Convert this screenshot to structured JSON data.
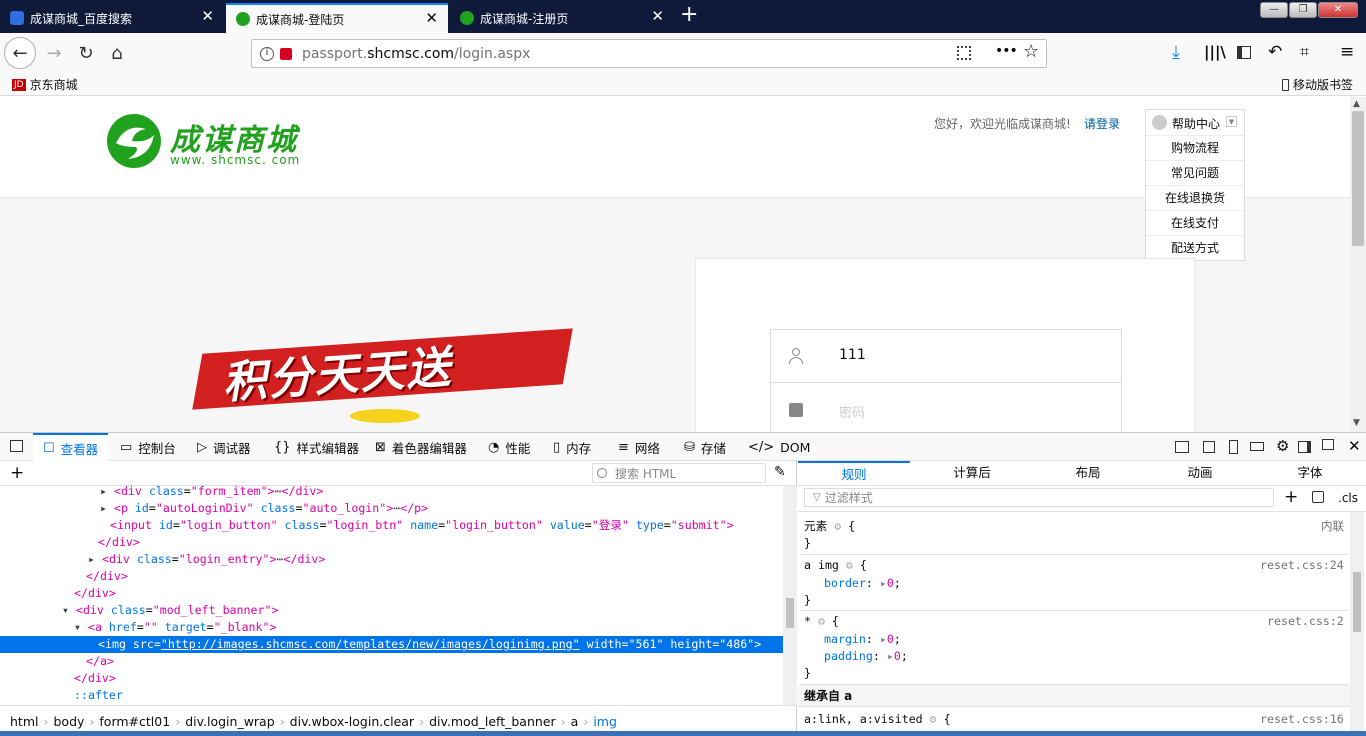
{
  "tabs": [
    {
      "title": "成谋商城_百度搜索",
      "close": "✕"
    },
    {
      "title": "成谋商城-登陆页",
      "close": "✕"
    },
    {
      "title": "成谋商城-注册页",
      "close": "✕"
    }
  ],
  "new_tab": "+",
  "window_controls": {
    "minimize": "—",
    "maximize": "❐",
    "close": "✕"
  },
  "nav": {
    "back": "←",
    "forward": "→",
    "reload": "↻",
    "home": "⌂"
  },
  "url": {
    "prefix": "passport.",
    "domain": "shcmsc.com",
    "path": "/login.aspx"
  },
  "toolbar_icons": [
    "qr-code-icon",
    "more-icon",
    "star-icon",
    "download-icon",
    "library-icon",
    "sidebar-icon",
    "undo-icon",
    "crop-icon",
    "menu-icon"
  ],
  "bookmarks": {
    "left_badge": "JD",
    "left": "京东商城",
    "right": "移动版书签"
  },
  "site": {
    "logo_cn": "成谋商城",
    "logo_url": "www. shcmsc. com",
    "welcome": "您好，欢迎光临成谋商城!",
    "login_link": "请登录",
    "help_center": "帮助中心",
    "help_menu": [
      "购物流程",
      "常见问题",
      "在线退换货",
      "在线支付",
      "配送方式"
    ],
    "banner": "积分天天送",
    "username_value": "111",
    "password_placeholder": "密码"
  },
  "devtools": {
    "tabs": [
      "查看器",
      "控制台",
      "调试器",
      "样式编辑器",
      "着色器编辑器",
      "性能",
      "内存",
      "网络",
      "存储",
      "DOM"
    ],
    "add": "+",
    "search_placeholder": "搜索 HTML",
    "html_lines": [
      {
        "a": "<div ",
        "b": "class=",
        "c": "\"form_item\"",
        "d": ">",
        "e": "",
        "f": "</div>"
      },
      {
        "a": "<p ",
        "b": "id=",
        "c": "\"autoLoginDiv\"",
        "d": " class=\"auto_login\">",
        "e": "",
        "f": "</p>"
      }
    ],
    "markup": [
      "<div class=\"form_item\">",
      "<p id=\"autoLoginDiv\" class=\"auto_login\">",
      "<input id=\"login_button\" class=\"login_btn\" name=\"login_button\" value=\"登录\" type=\"submit\">",
      "</div>",
      "<div class=\"login_entry\">",
      "</div>",
      "</div>",
      "<div class=\"mod_left_banner\">",
      "<a href=\"\" target=\"_blank\">",
      "<img src=\"http://images.shcmsc.com/templates/new/images/loginimg.png\" width=\"561\" height=\"486\">",
      "</a>",
      "</div>",
      "::after"
    ],
    "breadcrumbs": [
      "html",
      "body",
      "form#ctl01",
      "div.login_wrap",
      "div.wbox-login.clear",
      "div.mod_left_banner",
      "a",
      "img"
    ],
    "rule_tabs": [
      "规则",
      "计算后",
      "布局",
      "动画",
      "字体"
    ],
    "filter_placeholder": "过滤样式",
    "cls": ".cls",
    "rules": [
      {
        "selector": "元素",
        "source": "内联",
        "decls": []
      },
      {
        "selector": "a img",
        "source": "reset.css:24",
        "decls": [
          {
            "p": "border",
            "v": "0"
          }
        ]
      },
      {
        "selector": "*",
        "source": "reset.css:2",
        "decls": [
          {
            "p": "margin",
            "v": "0"
          },
          {
            "p": "padding",
            "v": "0"
          }
        ]
      }
    ],
    "inherited": "继承自 a",
    "last_rule": {
      "selector": "a:link, a:visited",
      "source": "reset.css:16"
    }
  }
}
